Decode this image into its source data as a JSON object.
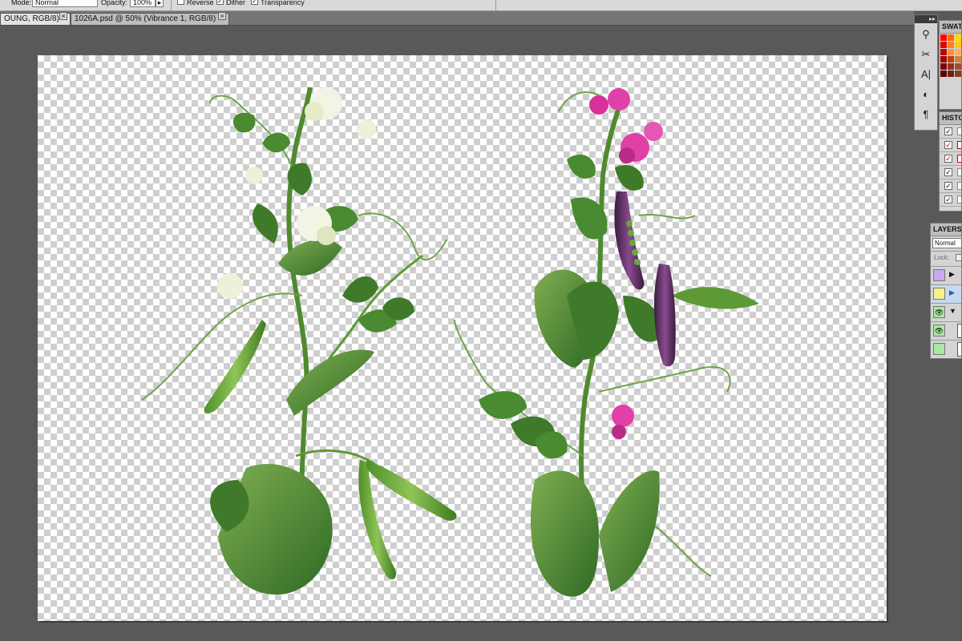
{
  "options_bar": {
    "mode_label": "Mode:",
    "mode_value": "Normal",
    "opacity_label": "Opacity:",
    "opacity_value": "100%",
    "reverse_label": "Reverse",
    "dither_label": "Dither",
    "transparency_label": "Transparency",
    "reverse_checked": false,
    "dither_checked": true,
    "transparency_checked": true
  },
  "tabs": [
    {
      "label": "OUNG, RGB/8) *",
      "active": true
    },
    {
      "label": "1026A.psd @ 50% (Vibrance 1, RGB/8) *",
      "active": false
    }
  ],
  "tools_panel": {
    "icons": [
      "brush-preset-icon",
      "tool-preset-icon",
      "character-icon",
      "paragraph-style-icon",
      "paragraph-icon"
    ]
  },
  "swatches_panel": {
    "title": "SWAT",
    "colors": [
      "#ff0000",
      "#ff6a00",
      "#ffd800",
      "#b6ff00",
      "#4cff00",
      "#00ff21",
      "#e00000",
      "#ff7f27",
      "#ffc90e",
      "#ffff40",
      "#a0d000",
      "#22b14c",
      "#c00000",
      "#ff9040",
      "#ffb060",
      "#ffe080",
      "#80c040",
      "#008000",
      "#a00000",
      "#c04000",
      "#d08040",
      "#e0b060",
      "#608020",
      "#006000",
      "#800000",
      "#903020",
      "#a05030",
      "#b07040",
      "#405020",
      "#004000",
      "#600000",
      "#702010",
      "#804020",
      "#905030",
      "#303010",
      "#003000"
    ]
  },
  "history_panel": {
    "title": "HISTO"
  },
  "layers_panel": {
    "title": "LAYERS",
    "blend_mode": "Normal",
    "lock_label": "Lock:",
    "rows": [
      {
        "color": "#c9a8f0",
        "visible": false
      },
      {
        "color": "#f5f08c",
        "visible": false
      },
      {
        "color": "#a8e8a0",
        "visible": true
      },
      {
        "color": "#a8e8a0",
        "visible": true
      },
      {
        "color": "#a8e8a0",
        "visible": false
      }
    ]
  },
  "document": {
    "canvas_background": "transparent-checkerboard",
    "artwork": [
      {
        "subject": "green pea plant with white flowers and green pods"
      },
      {
        "subject": "purple pea plant with magenta flowers and purple pods"
      }
    ]
  }
}
